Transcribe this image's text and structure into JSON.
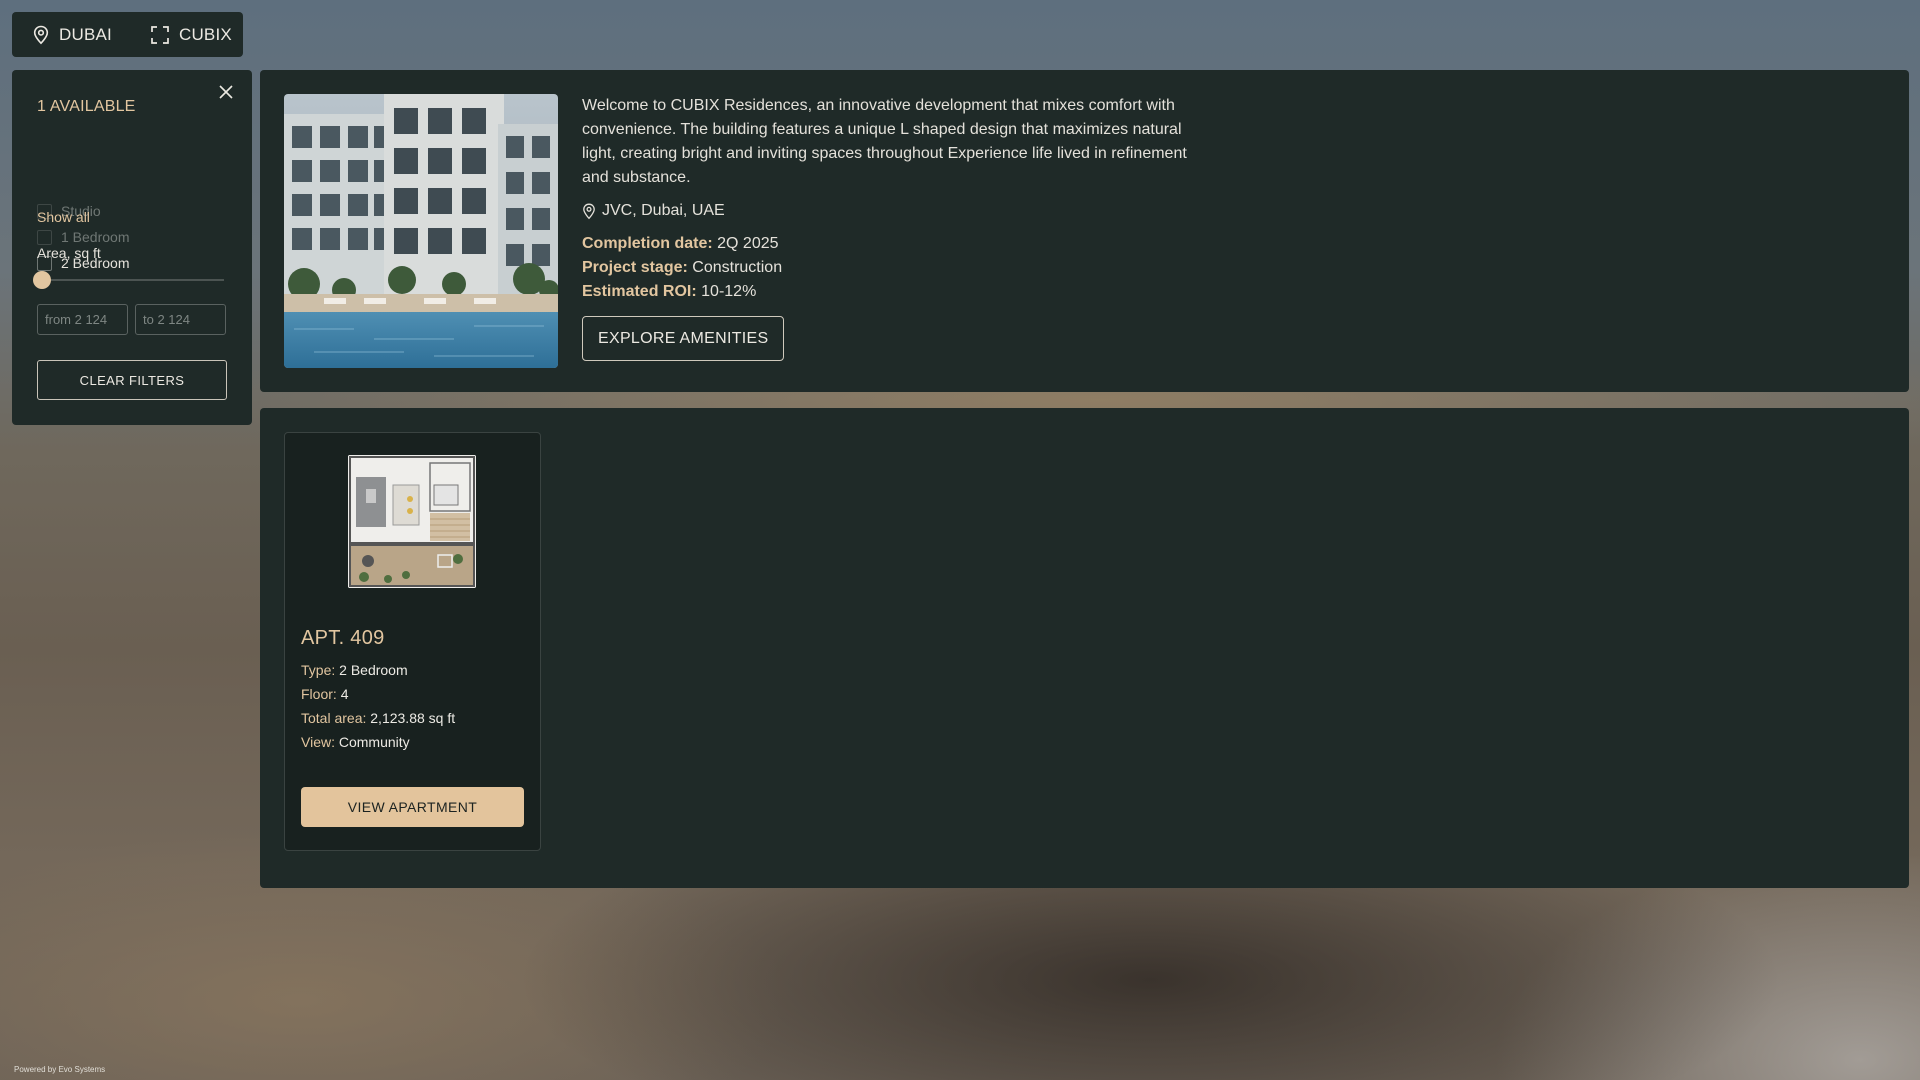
{
  "topbar": {
    "city": "DUBAI",
    "project": "CUBIX"
  },
  "filters": {
    "available": "1 AVAILABLE",
    "options": [
      {
        "label": "Studio",
        "enabled": false
      },
      {
        "label": "1 Bedroom",
        "enabled": false
      },
      {
        "label": "2 Bedroom",
        "enabled": true
      }
    ],
    "show_all": "Show all",
    "area_label": "Area, sq ft",
    "from_placeholder": "from 2 124",
    "to_placeholder": "to 2 124",
    "clear_label": "CLEAR FILTERS"
  },
  "project": {
    "description": "Welcome to CUBIX Residences, an innovative development that mixes comfort with convenience. The building features a unique L shaped design that maximizes natural light, creating bright and inviting spaces throughout Experience life lived in refinement and substance.",
    "location": "JVC, Dubai, UAE",
    "facts": [
      {
        "label": "Completion date:",
        "value": "2Q 2025"
      },
      {
        "label": "Project stage:",
        "value": "Construction"
      },
      {
        "label": "Estimated ROI:",
        "value": "10-12%"
      }
    ],
    "explore_label": "EXPLORE AMENITIES"
  },
  "listing": {
    "apartments": [
      {
        "title": "APT. 409",
        "type_label": "Type:",
        "type": "2 Bedroom",
        "floor_label": "Floor:",
        "floor": "4",
        "area_label": "Total area:",
        "area": "2,123.88 sq ft",
        "view_label": "View:",
        "view": "Community",
        "button": "VIEW APARTMENT"
      }
    ]
  },
  "footer": {
    "powered": "Powered by Evo Systems"
  },
  "colors": {
    "panel": "#1f2a28",
    "accent": "#e2c6a0",
    "button_fill": "#e3c49c"
  }
}
